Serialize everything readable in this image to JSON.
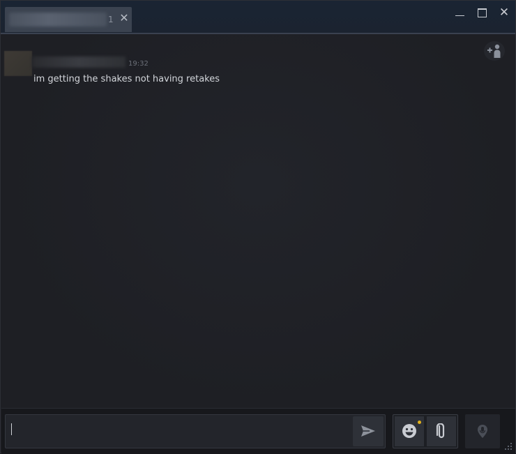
{
  "tab": {
    "count": "1"
  },
  "window": {
    "minimize_label": "minimize",
    "maximize_label": "maximize",
    "close_label": "close"
  },
  "messages": [
    {
      "time": "19:32",
      "text": "im getting the shakes not having retakes"
    }
  ],
  "input": {
    "value": ""
  },
  "icons": {
    "tab_close": "close-icon",
    "add_friend": "add-friend-icon",
    "send": "send-icon",
    "emoji": "emoji-icon",
    "attach": "paperclip-icon",
    "voice": "microphone-icon",
    "resize": "resize-grip-icon"
  },
  "colors": {
    "notification_dot": "#e2b21c",
    "background": "#1e1f24",
    "titlebar": "#1a2433"
  }
}
